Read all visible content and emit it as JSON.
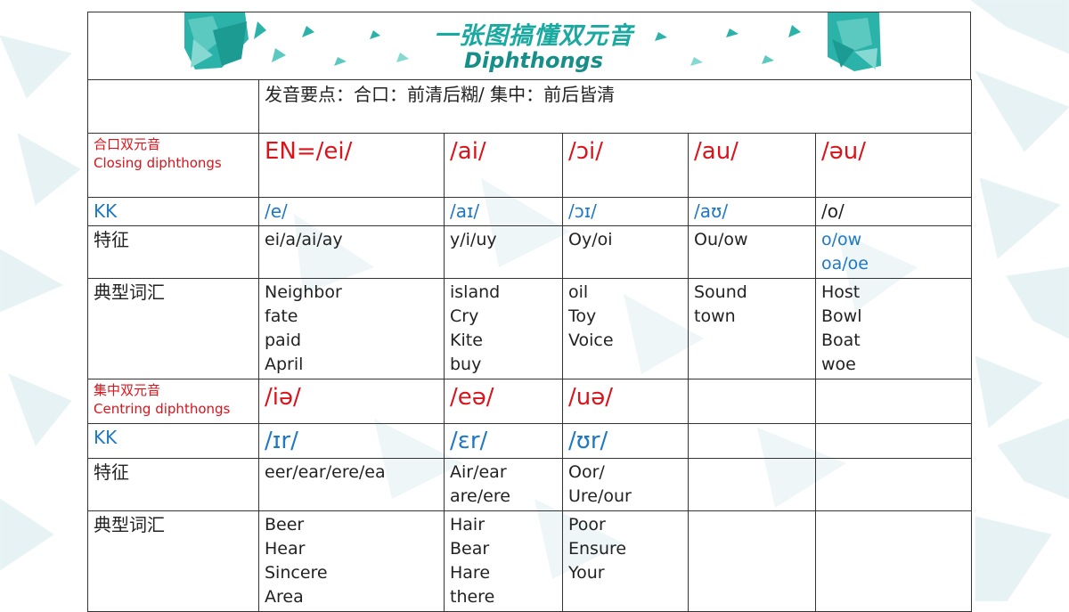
{
  "banner": {
    "title_cn": "一张图搞懂双元音",
    "title_en": "Diphthongs"
  },
  "notes": "发音要点：合口：前清后糊/ 集中：前后皆清",
  "closing": {
    "label_cn": "合口双元音",
    "label_en": "Closing diphthongs",
    "headers": [
      "EN=/ei/",
      "/ai/",
      "/ɔi/",
      "/au/",
      "/əu/"
    ],
    "kk_label": "KK",
    "kk": [
      "/e/",
      "/aɪ/",
      "/ɔɪ/",
      "/aʊ/",
      "/o/"
    ],
    "feature_label": "特征",
    "features": [
      [
        "ei/a/ai/ay"
      ],
      [
        "y/i/uy"
      ],
      [
        "Oy/oi"
      ],
      [
        "Ou/ow"
      ],
      [
        "o/ow",
        "oa/oe"
      ]
    ],
    "words_label": "典型词汇",
    "words": [
      [
        "Neighbor",
        "fate",
        "paid",
        "April"
      ],
      [
        "island",
        "Cry",
        "Kite",
        "buy"
      ],
      [
        "oil",
        "Toy",
        "Voice"
      ],
      [
        "Sound",
        "town"
      ],
      [
        "Host",
        "Bowl",
        "Boat",
        "woe"
      ]
    ]
  },
  "centring": {
    "label_cn": "集中双元音",
    "label_en": "Centring diphthongs",
    "headers": [
      "/iə/",
      "/eə/",
      "/uə/",
      "",
      ""
    ],
    "kk_label": "KK",
    "kk": [
      "/ɪr/",
      "/ɛr/",
      "/ʊr/",
      "",
      ""
    ],
    "feature_label": "特征",
    "features": [
      [
        "eer/ear/ere/ea"
      ],
      [
        "Air/ear",
        "are/ere"
      ],
      [
        "Oor/",
        "Ure/our"
      ],
      [],
      []
    ],
    "words_label": "典型词汇",
    "words": [
      [
        "Beer",
        "Hear",
        "Sincere",
        "Area"
      ],
      [
        "Hair",
        "Bear",
        "Hare",
        "there"
      ],
      [
        "Poor",
        "Ensure",
        "Your"
      ],
      [],
      []
    ]
  },
  "colors": {
    "red": "#d9141b",
    "blue": "#1e78c2",
    "teal": "#1aa9a0"
  }
}
